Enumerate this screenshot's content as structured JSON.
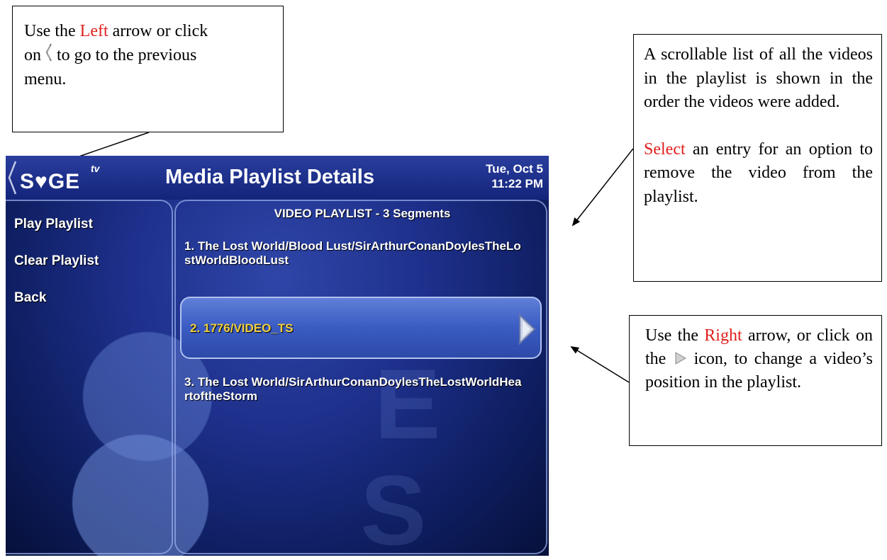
{
  "callouts": {
    "left": {
      "line1_pre": "Use the ",
      "line1_red": "Left",
      "line1_post": " arrow or click",
      "line2_pre": "on ",
      "line2_post": " to go to the previous",
      "line3": "menu.",
      "icon": "back-chevron-icon"
    },
    "top_right": {
      "para1": "A scrollable list of all the videos in the playlist is shown in the order the videos were added.",
      "para2_red": "Select",
      "para2_post": " an entry for an option to remove the video from the playlist."
    },
    "bottom_right": {
      "pre": "Use the ",
      "red": "Right",
      "mid": " arrow, or click on the ",
      "post": " icon, to change a video’s position in the playlist.",
      "icon": "play-triangle-icon"
    }
  },
  "app": {
    "logo": "S♥GE",
    "logo_superscript": "tv",
    "title": "Media Playlist Details",
    "date": "Tue, Oct 5",
    "time": "11:22 PM"
  },
  "menu": {
    "items": [
      {
        "label": "Play Playlist"
      },
      {
        "label": "Clear Playlist"
      },
      {
        "label": "Back"
      }
    ]
  },
  "playlist": {
    "heading": "VIDEO PLAYLIST - 3 Segments",
    "videos": [
      {
        "label": "1. The Lost World/Blood Lust/SirArthurConanDoylesTheLostWorldBloodLust"
      },
      {
        "label": "2. 1776/VIDEO_TS",
        "selected": true
      },
      {
        "label": "3. The Lost World/SirArthurConanDoylesTheLostWorldHeartoftheStorm"
      }
    ]
  },
  "colors": {
    "accent_red": "#e0201c",
    "selected_text": "#f0d040",
    "background": "#1d2f8a"
  }
}
